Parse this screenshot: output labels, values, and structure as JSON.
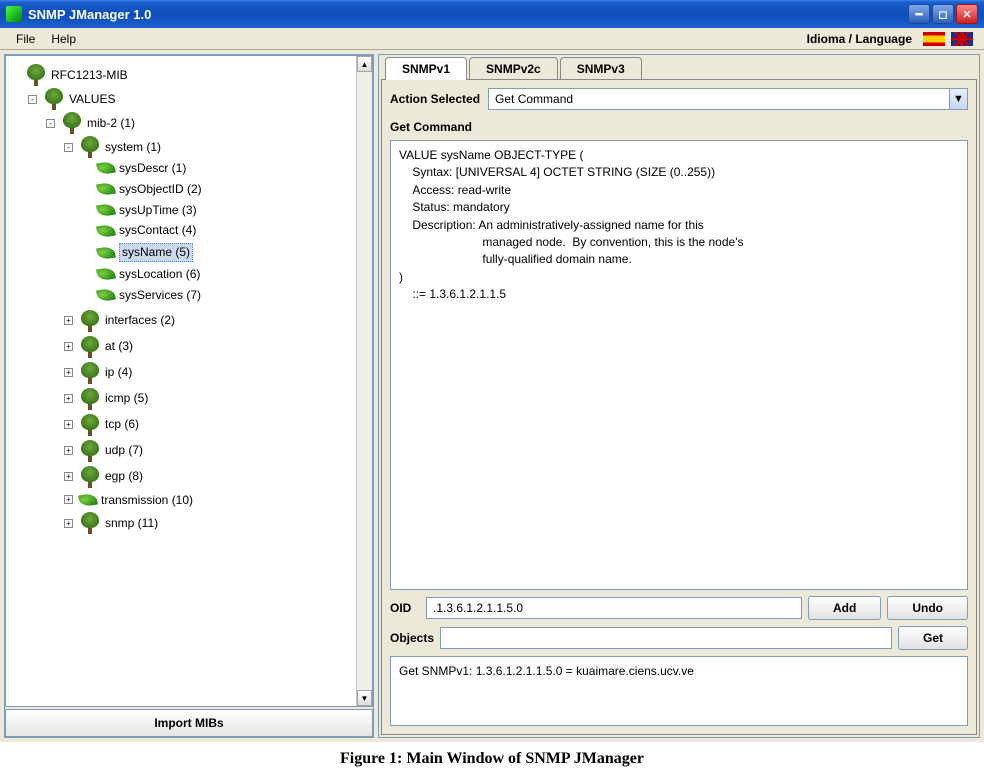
{
  "window": {
    "title": "SNMP JManager 1.0"
  },
  "menu": {
    "file": "File",
    "help": "Help",
    "language_label": "Idioma / Language"
  },
  "tree": {
    "root": "RFC1213-MIB",
    "values": "VALUES",
    "mib2": "mib-2 (1)",
    "system": "system (1)",
    "system_children": [
      "sysDescr (1)",
      "sysObjectID (2)",
      "sysUpTime (3)",
      "sysContact (4)",
      "sysName (5)",
      "sysLocation (6)",
      "sysServices (7)"
    ],
    "others": [
      "interfaces (2)",
      "at (3)",
      "ip (4)",
      "icmp (5)",
      "tcp (6)",
      "udp (7)",
      "egp (8)",
      "transmission (10)",
      "snmp (11)"
    ],
    "selected_index": 4
  },
  "import_btn": "Import MIBs",
  "tabs": [
    "SNMPv1",
    "SNMPv2c",
    "SNMPv3"
  ],
  "action": {
    "label": "Action Selected",
    "value": "Get Command"
  },
  "get_command_label": "Get Command",
  "definition": "VALUE sysName OBJECT-TYPE (\n    Syntax: [UNIVERSAL 4] OCTET STRING (SIZE (0..255))\n    Access: read-write\n    Status: mandatory\n    Description: An administratively-assigned name for this\n                         managed node.  By convention, this is the node's\n                         fully-qualified domain name.\n)\n    ::= 1.3.6.1.2.1.1.5",
  "oid": {
    "label": "OID",
    "value": ".1.3.6.1.2.1.1.5.0"
  },
  "buttons": {
    "add": "Add",
    "undo": "Undo",
    "get": "Get"
  },
  "objects": {
    "label": "Objects",
    "value": ""
  },
  "results": "Get SNMPv1:\n1.3.6.1.2.1.1.5.0 = kuaimare.ciens.ucv.ve",
  "caption": "Figure 1: Main Window of SNMP JManager"
}
